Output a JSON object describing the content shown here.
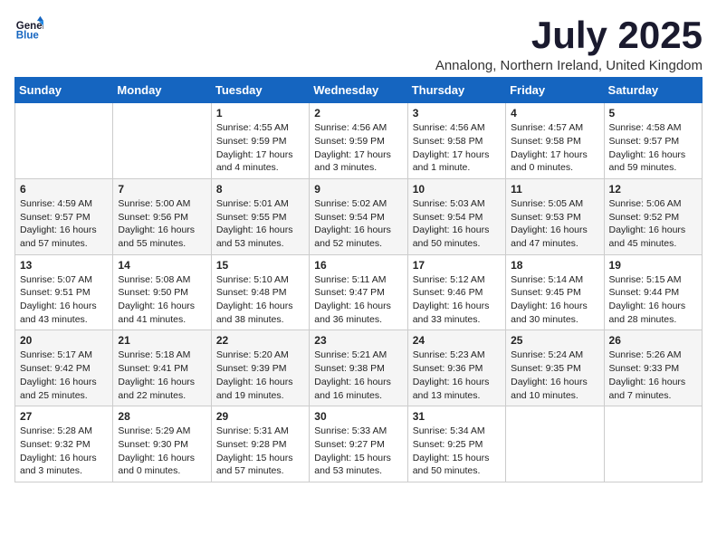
{
  "logo": {
    "line1": "General",
    "line2": "Blue"
  },
  "title": "July 2025",
  "location": "Annalong, Northern Ireland, United Kingdom",
  "weekdays": [
    "Sunday",
    "Monday",
    "Tuesday",
    "Wednesday",
    "Thursday",
    "Friday",
    "Saturday"
  ],
  "weeks": [
    [
      {
        "day": "",
        "info": ""
      },
      {
        "day": "",
        "info": ""
      },
      {
        "day": "1",
        "info": "Sunrise: 4:55 AM\nSunset: 9:59 PM\nDaylight: 17 hours\nand 4 minutes."
      },
      {
        "day": "2",
        "info": "Sunrise: 4:56 AM\nSunset: 9:59 PM\nDaylight: 17 hours\nand 3 minutes."
      },
      {
        "day": "3",
        "info": "Sunrise: 4:56 AM\nSunset: 9:58 PM\nDaylight: 17 hours\nand 1 minute."
      },
      {
        "day": "4",
        "info": "Sunrise: 4:57 AM\nSunset: 9:58 PM\nDaylight: 17 hours\nand 0 minutes."
      },
      {
        "day": "5",
        "info": "Sunrise: 4:58 AM\nSunset: 9:57 PM\nDaylight: 16 hours\nand 59 minutes."
      }
    ],
    [
      {
        "day": "6",
        "info": "Sunrise: 4:59 AM\nSunset: 9:57 PM\nDaylight: 16 hours\nand 57 minutes."
      },
      {
        "day": "7",
        "info": "Sunrise: 5:00 AM\nSunset: 9:56 PM\nDaylight: 16 hours\nand 55 minutes."
      },
      {
        "day": "8",
        "info": "Sunrise: 5:01 AM\nSunset: 9:55 PM\nDaylight: 16 hours\nand 53 minutes."
      },
      {
        "day": "9",
        "info": "Sunrise: 5:02 AM\nSunset: 9:54 PM\nDaylight: 16 hours\nand 52 minutes."
      },
      {
        "day": "10",
        "info": "Sunrise: 5:03 AM\nSunset: 9:54 PM\nDaylight: 16 hours\nand 50 minutes."
      },
      {
        "day": "11",
        "info": "Sunrise: 5:05 AM\nSunset: 9:53 PM\nDaylight: 16 hours\nand 47 minutes."
      },
      {
        "day": "12",
        "info": "Sunrise: 5:06 AM\nSunset: 9:52 PM\nDaylight: 16 hours\nand 45 minutes."
      }
    ],
    [
      {
        "day": "13",
        "info": "Sunrise: 5:07 AM\nSunset: 9:51 PM\nDaylight: 16 hours\nand 43 minutes."
      },
      {
        "day": "14",
        "info": "Sunrise: 5:08 AM\nSunset: 9:50 PM\nDaylight: 16 hours\nand 41 minutes."
      },
      {
        "day": "15",
        "info": "Sunrise: 5:10 AM\nSunset: 9:48 PM\nDaylight: 16 hours\nand 38 minutes."
      },
      {
        "day": "16",
        "info": "Sunrise: 5:11 AM\nSunset: 9:47 PM\nDaylight: 16 hours\nand 36 minutes."
      },
      {
        "day": "17",
        "info": "Sunrise: 5:12 AM\nSunset: 9:46 PM\nDaylight: 16 hours\nand 33 minutes."
      },
      {
        "day": "18",
        "info": "Sunrise: 5:14 AM\nSunset: 9:45 PM\nDaylight: 16 hours\nand 30 minutes."
      },
      {
        "day": "19",
        "info": "Sunrise: 5:15 AM\nSunset: 9:44 PM\nDaylight: 16 hours\nand 28 minutes."
      }
    ],
    [
      {
        "day": "20",
        "info": "Sunrise: 5:17 AM\nSunset: 9:42 PM\nDaylight: 16 hours\nand 25 minutes."
      },
      {
        "day": "21",
        "info": "Sunrise: 5:18 AM\nSunset: 9:41 PM\nDaylight: 16 hours\nand 22 minutes."
      },
      {
        "day": "22",
        "info": "Sunrise: 5:20 AM\nSunset: 9:39 PM\nDaylight: 16 hours\nand 19 minutes."
      },
      {
        "day": "23",
        "info": "Sunrise: 5:21 AM\nSunset: 9:38 PM\nDaylight: 16 hours\nand 16 minutes."
      },
      {
        "day": "24",
        "info": "Sunrise: 5:23 AM\nSunset: 9:36 PM\nDaylight: 16 hours\nand 13 minutes."
      },
      {
        "day": "25",
        "info": "Sunrise: 5:24 AM\nSunset: 9:35 PM\nDaylight: 16 hours\nand 10 minutes."
      },
      {
        "day": "26",
        "info": "Sunrise: 5:26 AM\nSunset: 9:33 PM\nDaylight: 16 hours\nand 7 minutes."
      }
    ],
    [
      {
        "day": "27",
        "info": "Sunrise: 5:28 AM\nSunset: 9:32 PM\nDaylight: 16 hours\nand 3 minutes."
      },
      {
        "day": "28",
        "info": "Sunrise: 5:29 AM\nSunset: 9:30 PM\nDaylight: 16 hours\nand 0 minutes."
      },
      {
        "day": "29",
        "info": "Sunrise: 5:31 AM\nSunset: 9:28 PM\nDaylight: 15 hours\nand 57 minutes."
      },
      {
        "day": "30",
        "info": "Sunrise: 5:33 AM\nSunset: 9:27 PM\nDaylight: 15 hours\nand 53 minutes."
      },
      {
        "day": "31",
        "info": "Sunrise: 5:34 AM\nSunset: 9:25 PM\nDaylight: 15 hours\nand 50 minutes."
      },
      {
        "day": "",
        "info": ""
      },
      {
        "day": "",
        "info": ""
      }
    ]
  ]
}
